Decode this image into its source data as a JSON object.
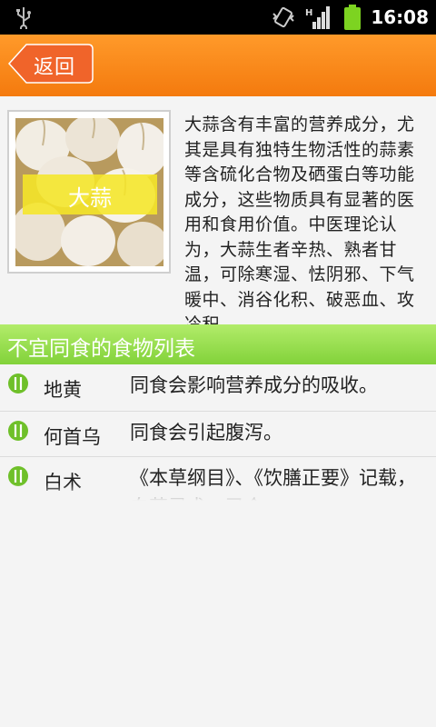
{
  "status_bar": {
    "time": "16:08",
    "network_label": "H",
    "icons": [
      "usb-icon",
      "vibrate-icon",
      "signal-icon",
      "battery-icon"
    ]
  },
  "header": {
    "back_label": "返回",
    "colors": {
      "background": "#f58418",
      "button": "#f06a2a"
    }
  },
  "intro": {
    "photo_label": "大蒜",
    "description": "大蒜含有丰富的营养成分，尤其是具有独特生物活性的蒜素等含硫化合物及硒蛋白等功能成分，这些物质具有显著的医用和食用价值。中医理论认为，大蒜生者辛热、熟者甘温，可除寒湿、怯阴邪、下气暖中、消谷化积、破恶血、攻冷积。"
  },
  "section": {
    "title": "不宜同食的食物列表",
    "color": "#8fd845"
  },
  "food_list": [
    {
      "name": "地黄",
      "effect": "同食会影响营养成分的吸收。"
    },
    {
      "name": "何首乌",
      "effect": "同食会引起腹泻。"
    },
    {
      "name": "白术",
      "effect": "《本草纲目》、《饮膳正要》记载，白蒜忌术，已会"
    }
  ]
}
